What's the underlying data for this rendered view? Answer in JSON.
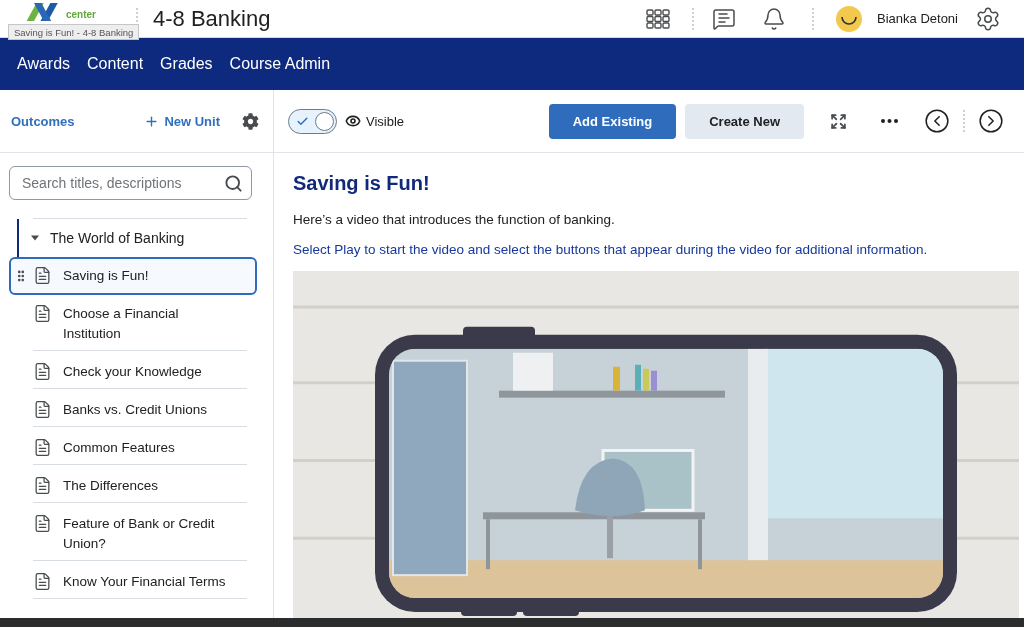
{
  "header": {
    "logo_text": "center",
    "course_title": "4-8 Banking",
    "user_name": "Bianka Detoni"
  },
  "tooltip": "Saving is Fun! - 4-8 Banking",
  "nav": [
    "Awards",
    "Content",
    "Grades",
    "Course Admin"
  ],
  "sidebar": {
    "outcomes_link": "Outcomes",
    "new_unit_button": "New Unit",
    "search": {
      "placeholder": "Search titles, descriptions"
    },
    "tree": [
      {
        "label": "The World of Banking",
        "expanded": true,
        "children": [
          {
            "label": "Saving is Fun!",
            "selected": true
          },
          {
            "label": "Choose a Financial Institution",
            "selected": false
          },
          {
            "label": "Check your Knowledge",
            "selected": false
          },
          {
            "label": "Banks vs. Credit Unions",
            "selected": false
          },
          {
            "label": "Common Features",
            "selected": false
          },
          {
            "label": "The Differences",
            "selected": false
          },
          {
            "label": "Feature of Bank or Credit Union?",
            "selected": false
          },
          {
            "label": "Know Your Financial Terms",
            "selected": false
          }
        ]
      }
    ]
  },
  "toolbar": {
    "visibility_toggle": {
      "on": true
    },
    "visibility_label": "Visible",
    "buttons": [
      {
        "label": "Add Existing",
        "kind": "primary"
      },
      {
        "label": "Create New",
        "kind": "secondary"
      }
    ]
  },
  "content": {
    "title": "Saving is Fun!",
    "paragraphs": [
      {
        "text": "Here’s a video that introduces the function of banking.",
        "kind": "plain"
      },
      {
        "text": "Select Play to start the video and select the buttons that appear during the video for additional information.",
        "kind": "instruction"
      }
    ]
  }
}
